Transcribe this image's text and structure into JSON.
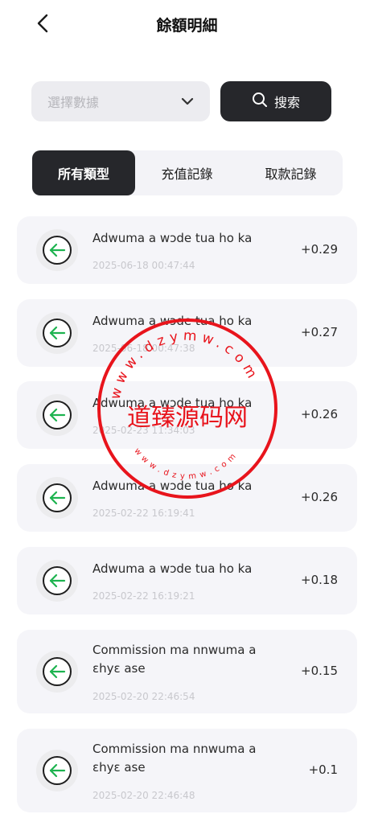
{
  "header": {
    "title": "餘額明細",
    "back_icon": "chevron-left-icon"
  },
  "filter": {
    "select_placeholder": "選擇數據",
    "search_label": "搜索"
  },
  "tabs": [
    {
      "label": "所有類型",
      "active": true
    },
    {
      "label": "充值記錄",
      "active": false
    },
    {
      "label": "取款記錄",
      "active": false
    }
  ],
  "records": [
    {
      "title": "Adwuma a wɔde tua ho ka",
      "time": "2025-06-18 00:47:44",
      "amount": "+0.29"
    },
    {
      "title": "Adwuma a wɔde tua ho ka",
      "time": "2025-06-18 00:47:38",
      "amount": "+0.27"
    },
    {
      "title": "Adwuma a wɔde tua ho ka",
      "time": "2025-02-23 11:34:03",
      "amount": "+0.26"
    },
    {
      "title": "Adwuma a wɔde tua ho ka",
      "time": "2025-02-22 16:19:41",
      "amount": "+0.26"
    },
    {
      "title": "Adwuma a wɔde tua ho ka",
      "time": "2025-02-22 16:19:21",
      "amount": "+0.18"
    },
    {
      "title": "Commission ma nnwuma a ɛhyɛ ase",
      "time": "2025-02-20 22:46:54",
      "amount": "+0.15"
    },
    {
      "title": "Commission ma nnwuma a ɛhyɛ ase",
      "time": "2025-02-20 22:46:48",
      "amount": "+0.1"
    }
  ],
  "watermark": {
    "text": "道臻源码网",
    "ring_text": "www.dzymw.com"
  },
  "colors": {
    "accent_green": "#1db34f",
    "dark": "#26272b",
    "watermark_red": "#e8141c"
  }
}
